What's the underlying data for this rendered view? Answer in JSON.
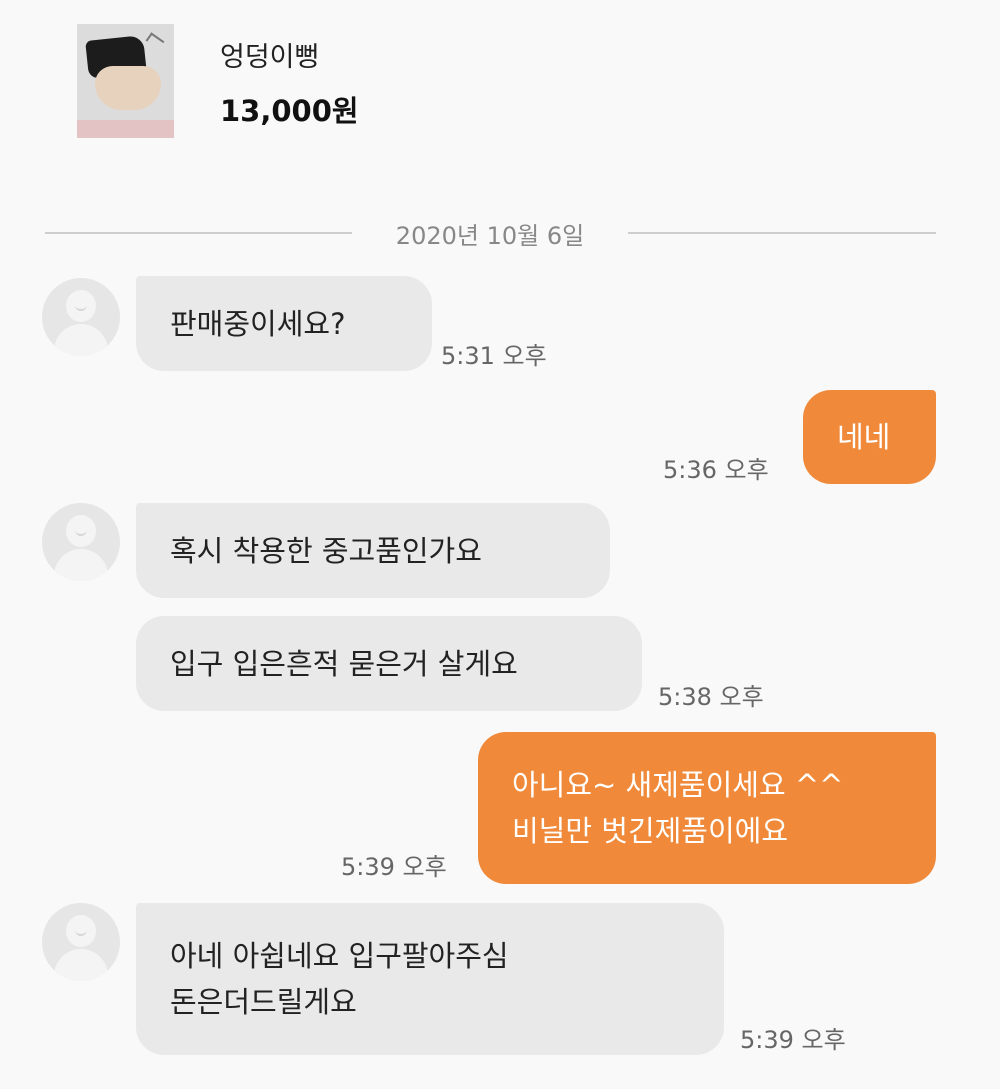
{
  "product": {
    "name": "엉덩이뻥",
    "price": "13,000원",
    "thumbnail_icon": "product-photo"
  },
  "date_divider": "2020년 10월 6일",
  "colors": {
    "incoming_bubble": "#e9e9e9",
    "outgoing_bubble": "#f08a3a",
    "background": "#f9f9f9"
  },
  "messages": [
    {
      "sender": "other",
      "text": "판매중이세요?",
      "time": "5:31 오후"
    },
    {
      "sender": "me",
      "text": "네네",
      "time": "5:36 오후"
    },
    {
      "sender": "other",
      "text": "혹시 착용한 중고품인가요",
      "time": ""
    },
    {
      "sender": "other",
      "text": "입구 입은흔적 묻은거 살게요",
      "time": "5:38 오후"
    },
    {
      "sender": "me",
      "lines": [
        "아니요~ 새제품이세요 ^^",
        "비닐만 벗긴제품이에요"
      ],
      "time": "5:39 오후"
    },
    {
      "sender": "other",
      "lines": [
        "아네 아쉽네요 입구팔아주심",
        "돈은더드릴게요"
      ],
      "time": "5:39 오후"
    }
  ]
}
